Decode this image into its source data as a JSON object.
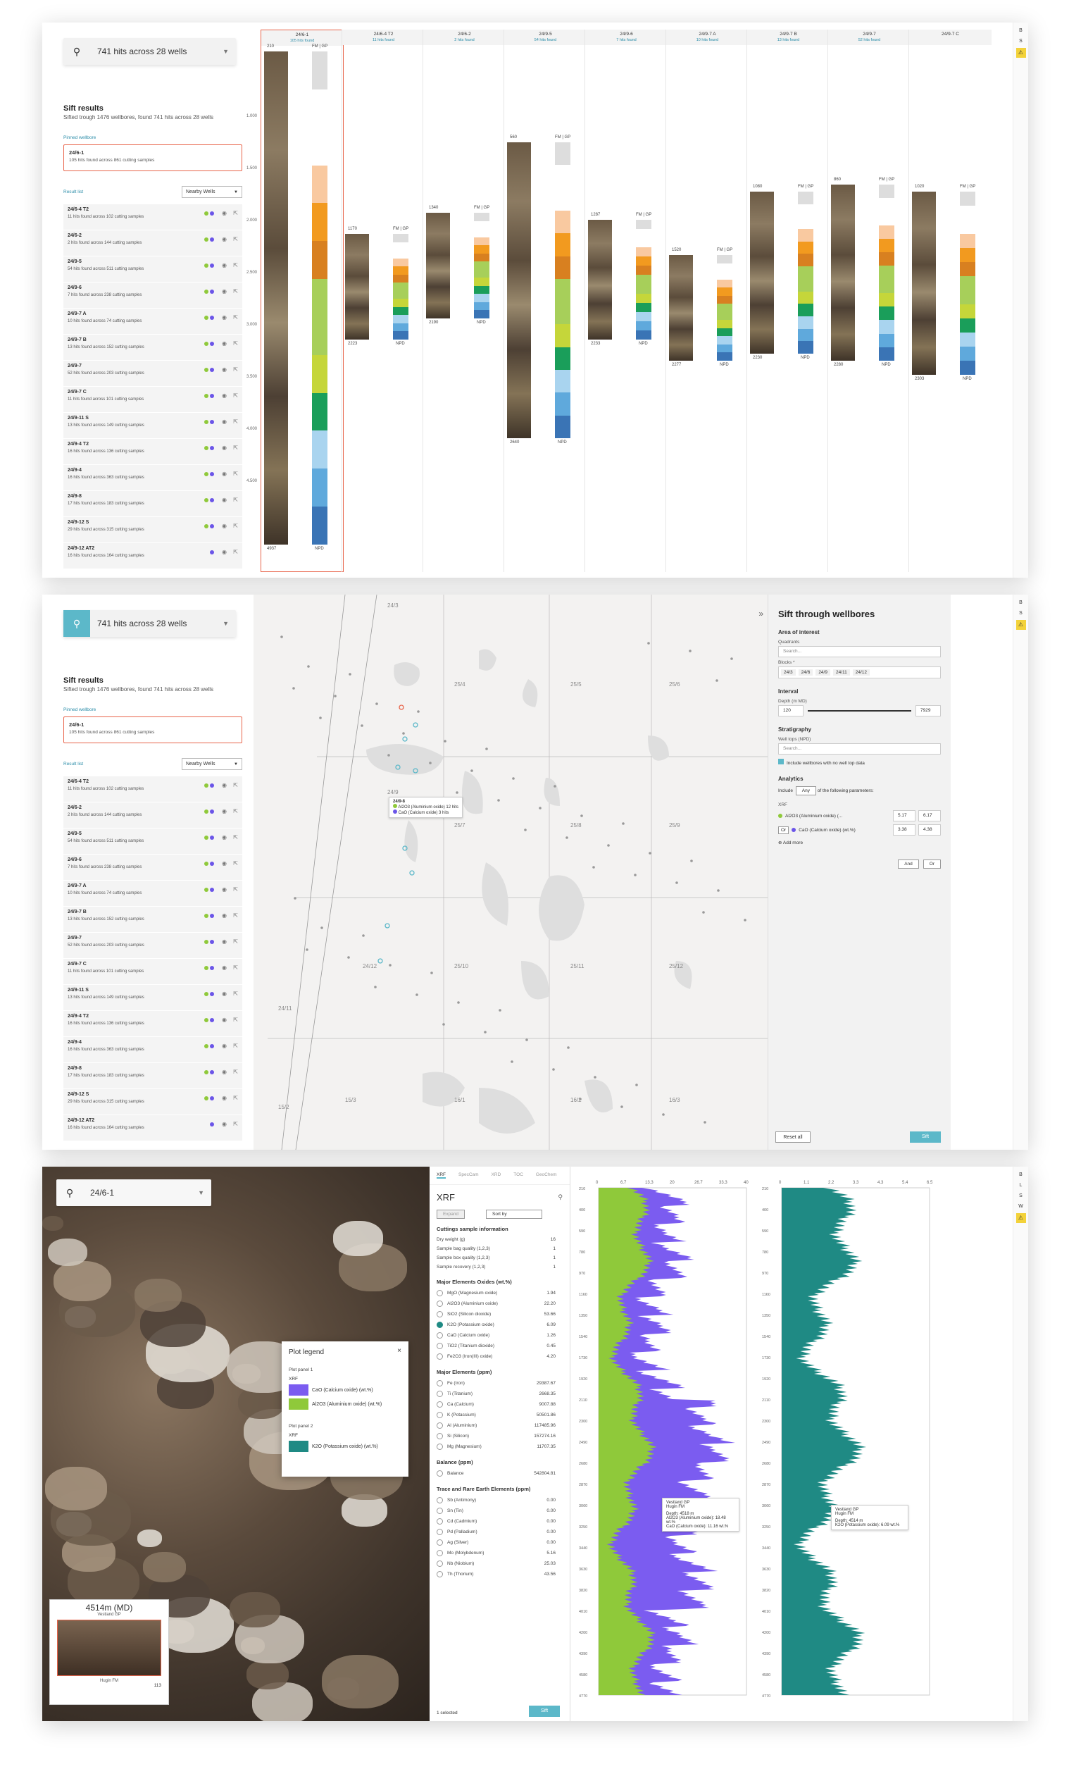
{
  "search": {
    "text": "741 hits across 28 wells",
    "pinned_text": "24/6-1"
  },
  "sift": {
    "title": "Sift results",
    "subtitle": "Sifted trough 1476 wellbores, found 741 hits across 28 wells",
    "pinned_label": "Pinned wellbore",
    "result_label": "Result list",
    "sort": "Nearby Wells",
    "pinned": {
      "name": "24/6-1",
      "sub": "105 hits found across 861 cutting samples"
    },
    "wells": [
      {
        "name": "24/6-4 T2",
        "sub": "11 hits found across 102 cutting samples",
        "g": true,
        "b": true
      },
      {
        "name": "24/6-2",
        "sub": "2 hits found across 144 cutting samples",
        "g": true,
        "b": true
      },
      {
        "name": "24/9-5",
        "sub": "54 hits found across 511 cutting samples",
        "g": true,
        "b": true
      },
      {
        "name": "24/9-6",
        "sub": "7 hits found across 238 cutting samples",
        "g": true,
        "b": true
      },
      {
        "name": "24/9-7 A",
        "sub": "10 hits found across 74 cutting samples",
        "g": true,
        "b": true
      },
      {
        "name": "24/9-7 B",
        "sub": "13 hits found across 152 cutting samples",
        "g": true,
        "b": true
      },
      {
        "name": "24/9-7",
        "sub": "52 hits found across 203 cutting samples",
        "g": true,
        "b": true
      },
      {
        "name": "24/9-7 C",
        "sub": "11 hits found across 101 cutting samples",
        "g": true,
        "b": true
      },
      {
        "name": "24/9-11 S",
        "sub": "13 hits found across 149 cutting samples",
        "g": true,
        "b": true
      },
      {
        "name": "24/9-4 T2",
        "sub": "16 hits found across 136 cutting samples",
        "g": true,
        "b": true
      },
      {
        "name": "24/9-4",
        "sub": "16 hits found across 363 cutting samples",
        "g": true,
        "b": true
      },
      {
        "name": "24/9-8",
        "sub": "17 hits found across 183 cutting samples",
        "g": true,
        "b": true
      },
      {
        "name": "24/9-12 S",
        "sub": "29 hits found across 315 cutting samples",
        "g": true,
        "b": true
      },
      {
        "name": "24/9-12 AT2",
        "sub": "16 hits found across 164 cutting samples",
        "g": false,
        "b": true
      }
    ]
  },
  "well_columns": [
    {
      "name": "24/6-1",
      "hits": "105 hits found",
      "top": "210",
      "bot": "4937"
    },
    {
      "name": "24/6-4 T2",
      "hits": "11 hits found",
      "top": "1170",
      "bot": "2223"
    },
    {
      "name": "24/6-2",
      "hits": "2 hits found",
      "top": "1340",
      "bot": "2190"
    },
    {
      "name": "24/9-5",
      "hits": "54 hits found",
      "top": "560",
      "bot": "2640"
    },
    {
      "name": "24/9-6",
      "hits": "7 hits found",
      "top": "1287",
      "bot": "2233"
    },
    {
      "name": "24/9-7 A",
      "hits": "10 hits found",
      "top": "1520",
      "bot": "2277"
    },
    {
      "name": "24/9-7 B",
      "hits": "13 hits found",
      "top": "1080",
      "bot": "2230"
    },
    {
      "name": "24/9-7",
      "hits": "52 hits found",
      "top": "860",
      "bot": "2280"
    },
    {
      "name": "24/9-7 C",
      "hits": "",
      "top": "1020",
      "bot": "2303"
    }
  ],
  "depth_ticks": [
    "1.000",
    "1.500",
    "2.000",
    "2.500",
    "3.000",
    "3.500",
    "4.000",
    "4.500"
  ],
  "fm_gp": "FM | GP",
  "npd": "NPD",
  "sift_panel": {
    "title": "Sift through wellbores",
    "aoi": "Area of interest",
    "quadrants": "Quadrants",
    "search_ph": "Search...",
    "blocks": "Blocks *",
    "block_chips": [
      "24/3",
      "24/6",
      "24/9",
      "24/11",
      "24/12"
    ],
    "interval": "Interval",
    "depth_lbl": "Depth (m MD)",
    "dmin": "120",
    "dmax": "7929",
    "strat": "Stratigraphy",
    "welltops": "Well tops (NPD)",
    "include_nodata": "Include wellbores with no well top data",
    "analytics": "Analytics",
    "include": "Include",
    "any": "Any",
    "following": "of the following parameters:",
    "xrf": "XRF",
    "p1": "Al2O3 (Aluminium oxide) (...",
    "p1a": "5.17",
    "p1b": "6.17",
    "or": "Or",
    "p2": "CaO (Calcium oxide) (wt.%)",
    "p2a": "3.38",
    "p2b": "4.38",
    "addmore": "Add more",
    "and_btn": "And",
    "or_btn": "Or",
    "reset": "Reset all",
    "sift": "Sift"
  },
  "map": {
    "blocks": [
      "24/3",
      "25/4",
      "25/5",
      "25/6",
      "24/9",
      "25/7",
      "25/8",
      "25/9",
      "24/12",
      "25/10",
      "25/11",
      "25/12",
      "24/11",
      "15/2",
      "15/3",
      "16/1",
      "16/2",
      "16/3"
    ],
    "popup_name": "24/9-8",
    "popup_l1": "Al2O3 (Aluminium oxide) 12 hits",
    "popup_l2": "CaO (Calcium oxide)  3 hits"
  },
  "xrf": {
    "tabs": [
      "XRF",
      "SpecCam",
      "XRD",
      "TOC",
      "GeoChem"
    ],
    "title": "XRF",
    "expand": "Expand",
    "sortby": "Sort by",
    "csi": "Cuttings sample information",
    "info": [
      [
        "Dry weight (g)",
        "16"
      ],
      [
        "Sample bag quality (1,2,3)",
        "1"
      ],
      [
        "Sample box quality (1,2,3)",
        "1"
      ],
      [
        "Sample recovery (1,2,3)",
        "1"
      ]
    ],
    "oxides_h": "Major Elements Oxides (wt.%)",
    "oxides": [
      [
        "MgO (Magnesium oxide)",
        "1.94"
      ],
      [
        "Al2O3 (Aluminium oxide)",
        "22.20"
      ],
      [
        "SiO2 (Silicon dioxide)",
        "53.66"
      ],
      [
        "K2O (Potassium oxide)",
        "6.09"
      ],
      [
        "CaO (Calcium oxide)",
        "1.26"
      ],
      [
        "TiO2 (Titanium dioxide)",
        "0.45"
      ],
      [
        "Fe2O3 (Iron(III) oxide)",
        "4.20"
      ]
    ],
    "elements_h": "Major Elements (ppm)",
    "elements": [
      [
        "Fe (Iron)",
        "29387.67"
      ],
      [
        "Ti (Titanium)",
        "2668.35"
      ],
      [
        "Ca (Calcium)",
        "9007.88"
      ],
      [
        "K (Potassium)",
        "50501.86"
      ],
      [
        "Al (Aluminium)",
        "117485.96"
      ],
      [
        "Si (Silicon)",
        "157274.16"
      ],
      [
        "Mg (Magnesium)",
        "11707.35"
      ]
    ],
    "balance_h": "Balance (ppm)",
    "balance": [
      [
        "Balance",
        "542804.81"
      ]
    ],
    "trace_h": "Trace and Rare Earth Elements (ppm)",
    "trace": [
      [
        "Sb (Antimony)",
        "0.00"
      ],
      [
        "Sn (Tin)",
        "0.00"
      ],
      [
        "Cd (Cadmium)",
        "0.00"
      ],
      [
        "Pd (Palladium)",
        "0.00"
      ],
      [
        "Ag (Silver)",
        "0.00"
      ],
      [
        "Mo (Molybdenum)",
        "5.16"
      ],
      [
        "Nb (Niobium)",
        "25.03"
      ],
      [
        "Th (Thorium)",
        "43.56"
      ]
    ],
    "selected": "1 selected",
    "sift": "Sift"
  },
  "legend": {
    "title": "Plot legend",
    "pp1": "Plot panel 1",
    "pp2": "Plot panel 2",
    "xrf": "XRF",
    "cao": "CaO (Calcium oxide) (wt.%)",
    "al": "Al2O3 (Aluminium oxide) (wt.%)",
    "k2o": "K2O (Potassium oxide) (wt.%)"
  },
  "depth_box": {
    "md": "4514m (MD)",
    "top": "Vestland GP",
    "bot": "Hugin FM",
    "zoom": "113"
  },
  "tooltip1": {
    "l1": "Vestland GP",
    "l2": "Hugin FM",
    "d": "Depth: 4518 m",
    "a": "Al2O3 (Aluminium oxide): 18.48 wt.%",
    "c": "CaO (Calcium oxide): 11.16 wt.%"
  },
  "tooltip2": {
    "l1": "Vestland GP",
    "l2": "Hugin FM",
    "d": "Depth: 4514 m",
    "k": "K2O (Potassium oxide): 6.09 wt.%"
  },
  "chart_data": [
    {
      "type": "area",
      "title": "",
      "series": [
        {
          "name": "CaO (Calcium oxide) (wt.%)"
        },
        {
          "name": "Al2O3 (Aluminium oxide) (wt.%)"
        }
      ],
      "xlim": [
        0,
        40
      ]
    },
    {
      "type": "area",
      "title": "",
      "series": [
        {
          "name": "K2O (Potassium oxide) (wt.%)"
        }
      ],
      "xlim": [
        0,
        6.5
      ]
    }
  ],
  "colors": {
    "accent": "#5cb8c9",
    "green": "#8fc93a",
    "purple": "#6b55e8",
    "teal": "#1f9a93",
    "orange": "#f29a1f",
    "warn": "#f3d23a"
  }
}
